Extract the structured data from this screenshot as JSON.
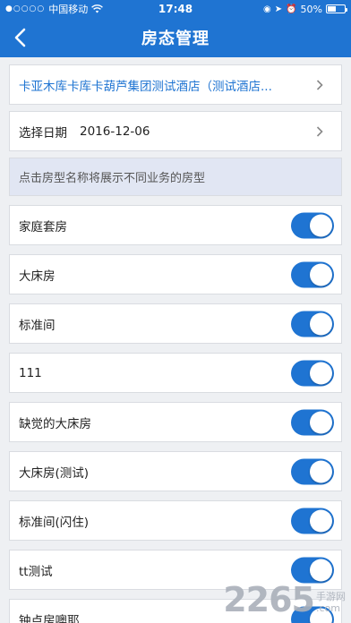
{
  "status_bar": {
    "carrier": "中国移动",
    "time": "17:48",
    "battery": "50%",
    "battery_level": 0.5
  },
  "nav": {
    "title": "房态管理",
    "back_icon": "chevron-left-icon"
  },
  "hotel": {
    "name": "卡亚木库卡库卡葫芦集团测试酒店（测试酒店..."
  },
  "date": {
    "label": "选择日期",
    "value": "2016-12-06"
  },
  "hint": "点击房型名称将展示不同业务的房型",
  "room_types": [
    {
      "name": "家庭套房",
      "enabled": true
    },
    {
      "name": "大床房",
      "enabled": true
    },
    {
      "name": "标准间",
      "enabled": true
    },
    {
      "name": "111",
      "enabled": true
    },
    {
      "name": "缺觉的大床房",
      "enabled": true
    },
    {
      "name": "大床房(测试)",
      "enabled": true
    },
    {
      "name": "标准间(闪住)",
      "enabled": true
    },
    {
      "name": "tt测试",
      "enabled": true
    },
    {
      "name": "钟点房噢耶",
      "enabled": true
    }
  ],
  "watermark": {
    "number": "2265",
    "line1": "手游网",
    "line2": ".com"
  },
  "colors": {
    "brand": "#1f74d2",
    "hint_bg": "#e1e6f3"
  }
}
